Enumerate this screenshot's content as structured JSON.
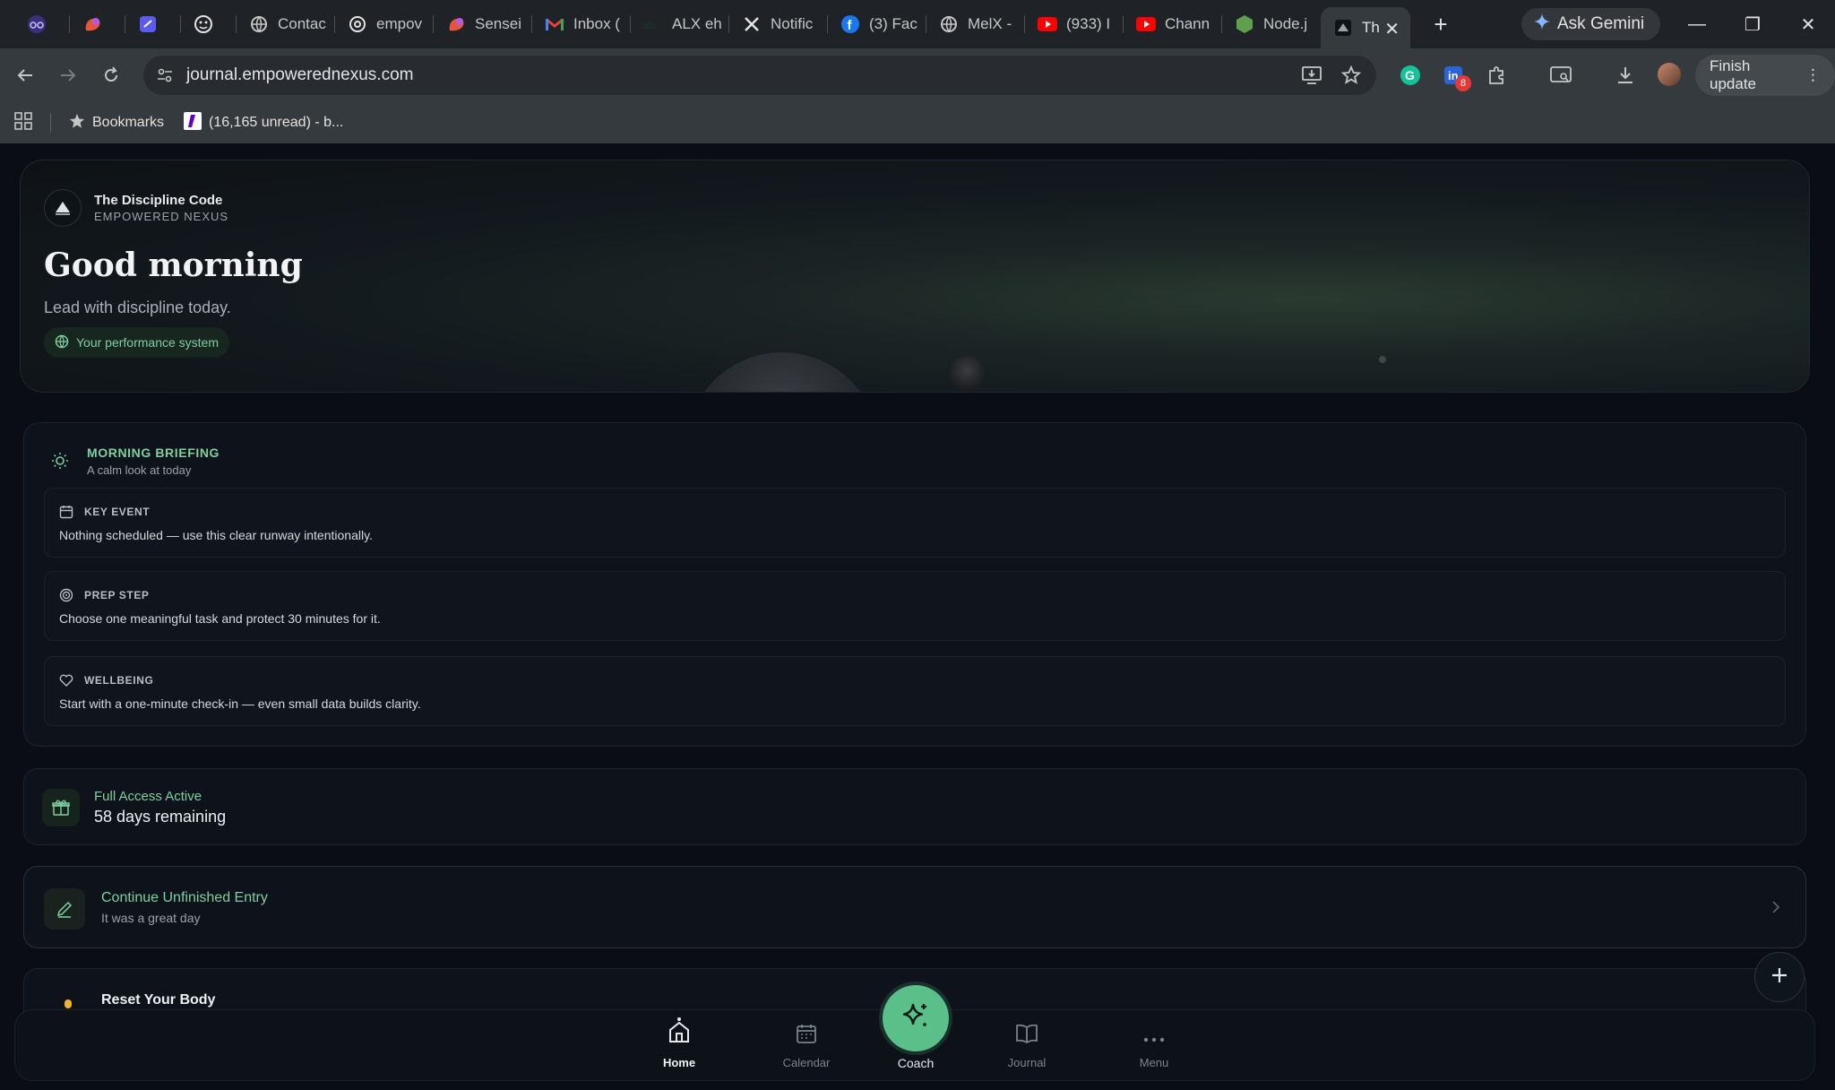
{
  "browser": {
    "tabs": [
      {
        "title": "",
        "icon": "glasses-icon",
        "color": "#6b5bd6"
      },
      {
        "title": "",
        "icon": "blob-icon",
        "color": "#e8553d"
      },
      {
        "title": "",
        "icon": "notes-icon",
        "color": "#5b5bf0"
      },
      {
        "title": "",
        "icon": "face-icon",
        "color": "#e3e3e3"
      },
      {
        "title": "Contac",
        "icon": "globe-icon"
      },
      {
        "title": "empov",
        "icon": "openai-icon"
      },
      {
        "title": "Sensei",
        "icon": "blob-icon"
      },
      {
        "title": "Inbox (",
        "icon": "gmail-icon"
      },
      {
        "title": "ALX eh",
        "icon": "alx-icon"
      },
      {
        "title": "Notific",
        "icon": "x-icon"
      },
      {
        "title": "(3) Fac",
        "icon": "facebook-icon"
      },
      {
        "title": "MelX -",
        "icon": "globe-icon"
      },
      {
        "title": "(933) I",
        "icon": "youtube-icon"
      },
      {
        "title": "Chann",
        "icon": "youtube-icon"
      },
      {
        "title": "Node.j",
        "icon": "node-icon"
      },
      {
        "title": "Th",
        "icon": "app-icon",
        "active": true
      }
    ],
    "new_tab": "+",
    "ask_gemini": "Ask Gemini",
    "url": "journal.empowerednexus.com",
    "finish_update": "Finish update",
    "extension_badge": "8",
    "bookmarks_label": "Bookmarks",
    "bookmark_item": "(16,165 unread) - b..."
  },
  "hero": {
    "brand_title": "The Discipline Code",
    "brand_sub": "EMPOWERED NEXUS",
    "greeting": "Good morning",
    "tagline": "Lead with discipline today.",
    "pill": "Your performance system"
  },
  "briefing": {
    "title": "MORNING BRIEFING",
    "subtitle": "A calm look at today",
    "cards": [
      {
        "label": "KEY EVENT",
        "text": "Nothing scheduled — use this clear runway intentionally.",
        "icon": "calendar-icon"
      },
      {
        "label": "PREP STEP",
        "text": "Choose one meaningful task and protect 30 minutes for it.",
        "icon": "target-icon"
      },
      {
        "label": "WELLBEING",
        "text": "Start with a one-minute check-in — even small data builds clarity.",
        "icon": "heart-icon"
      }
    ]
  },
  "access": {
    "title": "Full Access Active",
    "value": "58 days remaining"
  },
  "continue_entry": {
    "title": "Continue Unfinished Entry",
    "subtitle": "It was a great day"
  },
  "reset": {
    "title": "Reset Your Body"
  },
  "nav": {
    "home": "Home",
    "calendar": "Calendar",
    "coach": "Coach",
    "journal": "Journal",
    "menu": "Menu"
  },
  "colors": {
    "accent": "#7fcf9f",
    "coach": "#5bbf8a",
    "background": "#0a0e14"
  }
}
